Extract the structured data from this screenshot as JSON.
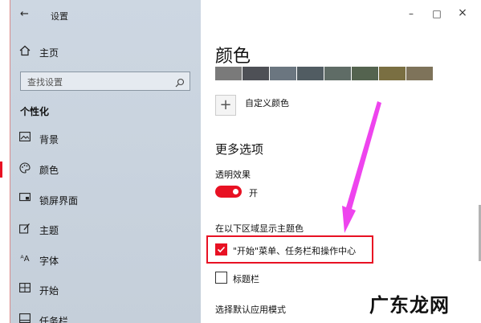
{
  "window": {
    "title": "设置",
    "back_icon": "back-arrow-icon",
    "controls": {
      "minimize": "–",
      "maximize": "□",
      "close": "×"
    }
  },
  "sidebar": {
    "home_label": "主页",
    "search_placeholder": "查找设置",
    "section_title": "个性化",
    "items": [
      {
        "label": "背景",
        "icon": "image-icon"
      },
      {
        "label": "颜色",
        "icon": "palette-icon",
        "active": true
      },
      {
        "label": "锁屏界面",
        "icon": "lock-screen-icon"
      },
      {
        "label": "主题",
        "icon": "theme-icon"
      },
      {
        "label": "字体",
        "icon": "font-icon"
      },
      {
        "label": "开始",
        "icon": "start-icon"
      },
      {
        "label": "任务栏",
        "icon": "taskbar-icon"
      }
    ]
  },
  "content": {
    "heading": "颜色",
    "swatches": [
      "#7a7a7a",
      "#4e5056",
      "#6b7680",
      "#515c62",
      "#5f6c66",
      "#54634f",
      "#7a6f42",
      "#7e735a"
    ],
    "custom_color_label": "自定义颜色",
    "more_options_heading": "更多选项",
    "transparency_label": "透明效果",
    "transparency_state": "开",
    "accent_surfaces_label": "在以下区域显示主题色",
    "checkbox_start": "\"开始\"菜单、任务栏和操作中心",
    "checkbox_titlebar": "标题栏",
    "app_mode_label": "选择默认应用模式"
  },
  "watermark": "广东龙网",
  "colors": {
    "accent": "#e81123",
    "annotation_arrow": "#ee44ee"
  }
}
